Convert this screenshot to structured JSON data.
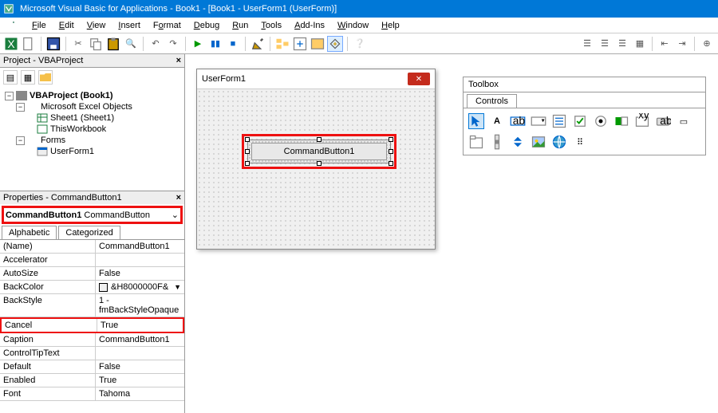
{
  "titlebar": {
    "text": "Microsoft Visual Basic for Applications - Book1 - [Book1 - UserForm1 (UserForm)]"
  },
  "menu": {
    "file": "File",
    "edit": "Edit",
    "view": "View",
    "insert": "Insert",
    "format": "Format",
    "debug": "Debug",
    "run": "Run",
    "tools": "Tools",
    "addins": "Add-Ins",
    "window": "Window",
    "help": "Help"
  },
  "project_pane": {
    "title": "Project - VBAProject",
    "root": "VBAProject (Book1)",
    "excel_objects": "Microsoft Excel Objects",
    "sheet": "Sheet1 (Sheet1)",
    "workbook": "ThisWorkbook",
    "forms": "Forms",
    "userform": "UserForm1"
  },
  "props_pane": {
    "title": "Properties - CommandButton1",
    "object_name": "CommandButton1",
    "object_type": "CommandButton",
    "tab_alpha": "Alphabetic",
    "tab_cat": "Categorized",
    "rows": [
      {
        "k": "(Name)",
        "v": "CommandButton1"
      },
      {
        "k": "Accelerator",
        "v": ""
      },
      {
        "k": "AutoSize",
        "v": "False"
      },
      {
        "k": "BackColor",
        "v": "&H8000000F&",
        "color": true,
        "dd": true
      },
      {
        "k": "BackStyle",
        "v": "1 - fmBackStyleOpaque"
      },
      {
        "k": "Cancel",
        "v": "True",
        "hl": true
      },
      {
        "k": "Caption",
        "v": "CommandButton1"
      },
      {
        "k": "ControlTipText",
        "v": ""
      },
      {
        "k": "Default",
        "v": "False"
      },
      {
        "k": "Enabled",
        "v": "True"
      },
      {
        "k": "Font",
        "v": "Tahoma"
      }
    ]
  },
  "designer": {
    "form_title": "UserForm1",
    "button_caption": "CommandButton1"
  },
  "toolbox": {
    "title": "Toolbox",
    "tab": "Controls"
  }
}
